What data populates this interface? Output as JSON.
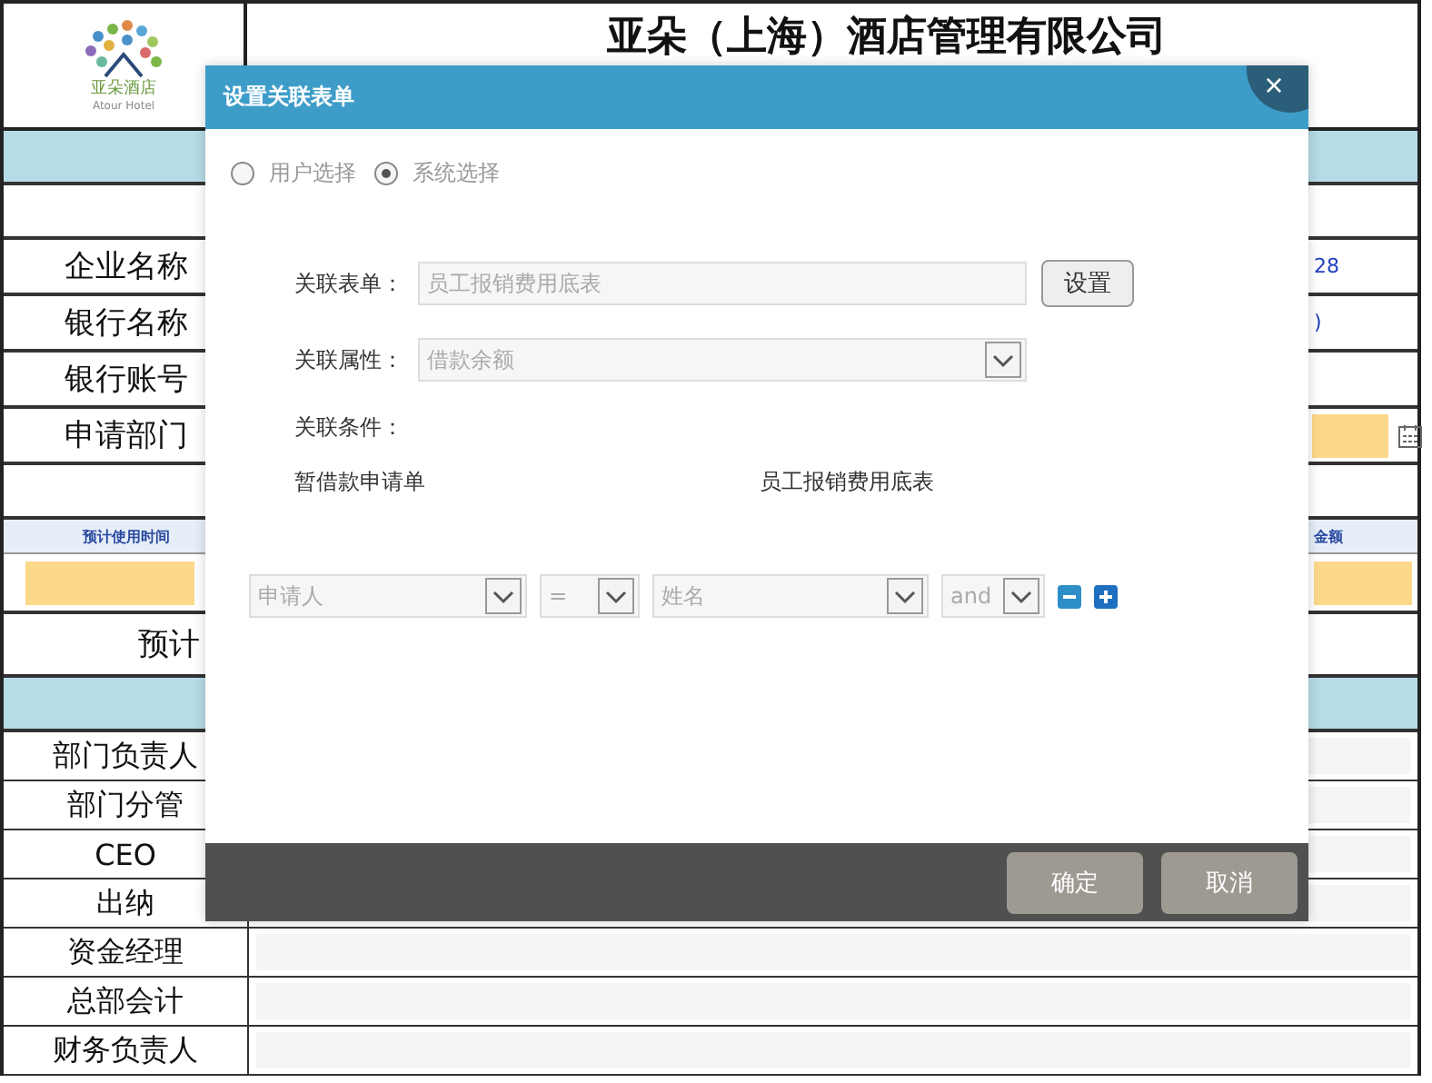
{
  "header": {
    "logo_name": "亚朵酒店",
    "logo_subtitle": "Atour Hotel",
    "title": "亚朵（上海）酒店管理有限公司"
  },
  "rows": [
    {
      "kind": "band"
    },
    {
      "kind": "blank"
    },
    {
      "kind": "field",
      "label": "企业名称",
      "value": "28"
    },
    {
      "kind": "field",
      "label": "银行名称",
      "value": ")"
    },
    {
      "kind": "field",
      "label": "银行账号"
    },
    {
      "kind": "date",
      "label": "申请部门"
    },
    {
      "kind": "blank"
    },
    {
      "kind": "subheader",
      "label": "预计使用时间",
      "value": "金额"
    },
    {
      "kind": "inputs"
    },
    {
      "kind": "total",
      "label": "预计"
    },
    {
      "kind": "band"
    },
    {
      "kind": "approver",
      "label": "部门负责人"
    },
    {
      "kind": "approver",
      "label": "部门分管"
    },
    {
      "kind": "approver",
      "label": "CEO"
    },
    {
      "kind": "approver",
      "label": "出纳"
    },
    {
      "kind": "approver",
      "label": "资金经理"
    },
    {
      "kind": "approver",
      "label": "总部会计"
    },
    {
      "kind": "approver",
      "label": "财务负责人"
    }
  ],
  "dialog": {
    "title": "设置关联表单",
    "close": "×",
    "modes": [
      {
        "label": "用户选择",
        "selected": false
      },
      {
        "label": "系统选择",
        "selected": true
      }
    ],
    "form_label": "关联表单：",
    "form_value": "员工报销费用底表",
    "set_button": "设置",
    "attr_label": "关联属性：",
    "attr_value": "借款余额",
    "condition_label": "关联条件：",
    "source": "暂借款申请单",
    "target": "员工报销费用底表",
    "condition": {
      "field": "申请人",
      "operator": "=",
      "target_field": "姓名",
      "joiner": "and"
    },
    "buttons": [
      "确定",
      "取消"
    ]
  }
}
